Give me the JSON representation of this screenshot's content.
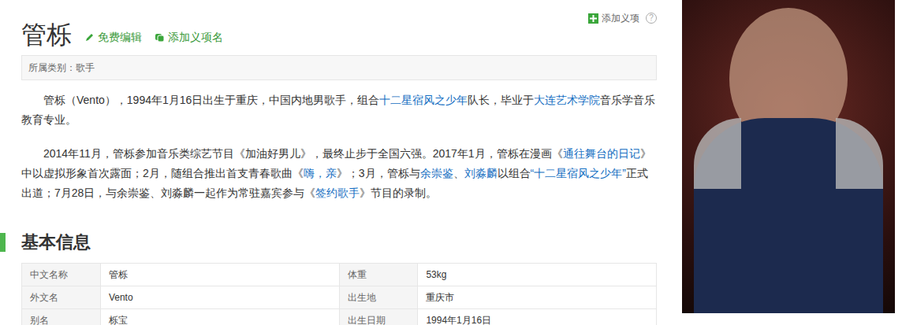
{
  "title": "管栎",
  "actions": [
    {
      "label": "免费编辑"
    },
    {
      "label": "添加义项名"
    }
  ],
  "top_action": {
    "label": "添加义项",
    "help": "?"
  },
  "category": {
    "label": "所属类别：",
    "value": "歌手"
  },
  "paragraphs": [
    [
      {
        "text": "管栎（Vento），1994年1月16日出生于重庆，中国内地男歌手，组合",
        "link": false
      },
      {
        "text": "十二星宿风之少年",
        "link": true
      },
      {
        "text": "队长，毕业于",
        "link": false
      },
      {
        "text": "大连艺术学院",
        "link": true
      },
      {
        "text": "音乐学音乐教育专业。",
        "link": false
      }
    ],
    [
      {
        "text": "2014年11月，管栎参加音乐类综艺节目《加油好男儿》，最终止步于全国六强。2017年1月，管栎在漫画《",
        "link": false
      },
      {
        "text": "通往舞台的日记",
        "link": true
      },
      {
        "text": "》中以虚拟形象首次露面；2月，随组合推出首支青春歌曲《",
        "link": false
      },
      {
        "text": "嗨，亲",
        "link": true
      },
      {
        "text": "》；3月，管栎与",
        "link": false
      },
      {
        "text": "余崇鉴",
        "link": true
      },
      {
        "text": "、",
        "link": false
      },
      {
        "text": "刘淼麟",
        "link": true
      },
      {
        "text": "以组合",
        "link": false
      },
      {
        "text": "“十二星宿风之少年”",
        "link": true
      },
      {
        "text": "正式出道；7月28日，与余崇鉴、刘淼麟一起作为常驻嘉宾参与《",
        "link": false
      },
      {
        "text": "签约歌手",
        "link": true
      },
      {
        "text": "》节目的录制。",
        "link": false
      }
    ]
  ],
  "section": {
    "title": "基本信息"
  },
  "info": {
    "rows": [
      [
        {
          "label": "中文名称",
          "value": "管栎"
        },
        {
          "label": "体重",
          "value": "53kg"
        }
      ],
      [
        {
          "label": "外文名",
          "value": "Vento"
        },
        {
          "label": "出生地",
          "value": "重庆市"
        }
      ],
      [
        {
          "label": "别名",
          "value": "栎宝"
        },
        {
          "label": "出生日期",
          "value": "1994年1月16日"
        }
      ]
    ]
  }
}
